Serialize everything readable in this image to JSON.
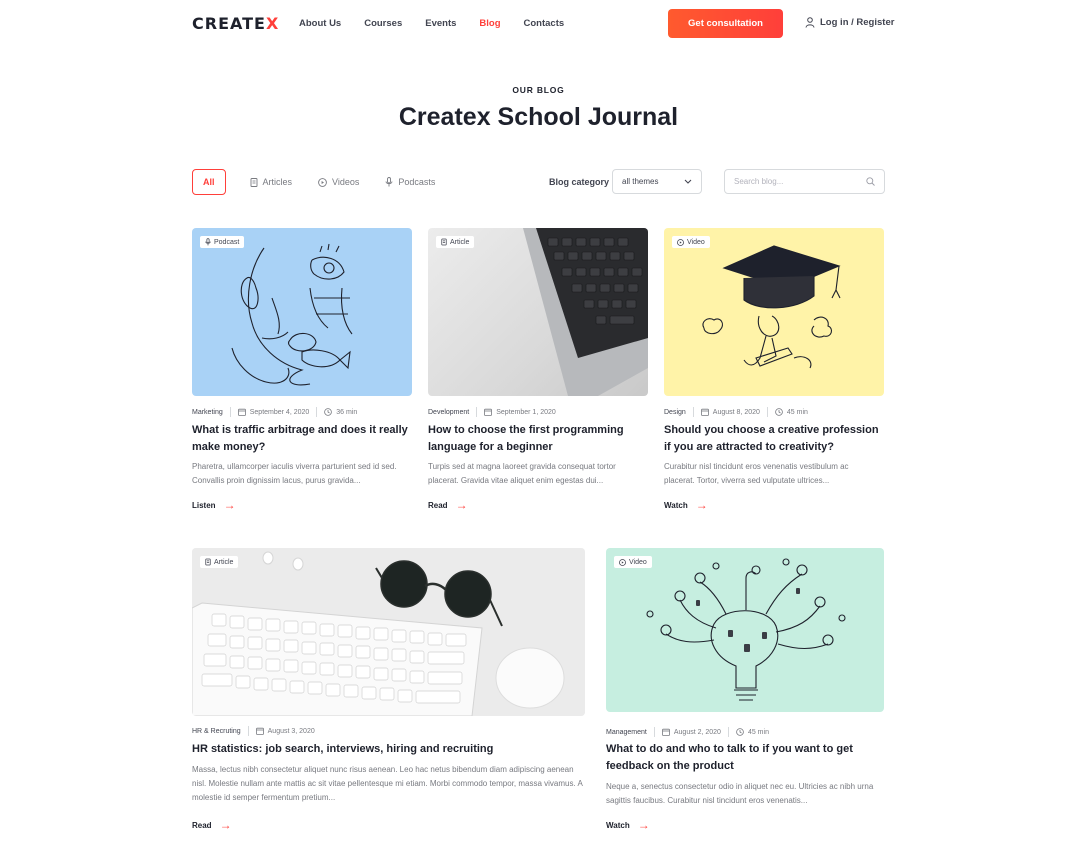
{
  "header": {
    "logo_main": "CREATE",
    "logo_x": "X",
    "nav": [
      "About Us",
      "Courses",
      "Events",
      "Blog",
      "Contacts"
    ],
    "active_nav": "Blog",
    "cta_label": "Get consultation",
    "login_label": "Log in / Register"
  },
  "hero": {
    "eyebrow": "OUR BLOG",
    "title": "Createx School Journal"
  },
  "filters": {
    "all": "All",
    "articles": "Articles",
    "videos": "Videos",
    "podcasts": "Podcasts",
    "category_label": "Blog category",
    "category_value": "all themes",
    "search_placeholder": "Search blog..."
  },
  "colors": {
    "accent": "#ff3f3a",
    "text_dark": "#1e212c",
    "text_muted": "#787a80",
    "podcast_bg": "#a9d2f6",
    "video_bg": "#fff3a8",
    "video2_bg": "#c6eee0"
  },
  "cards": [
    {
      "type": "Podcast",
      "type_icon": "microphone-icon",
      "category": "Marketing",
      "date": "September 4, 2020",
      "duration": "36 min",
      "title": "What is traffic arbitrage and does it really make money?",
      "excerpt": "Pharetra, ullamcorper iaculis viverra parturient sed id sed. Convallis proin dignissim lacus, purus gravida...",
      "action": "Listen"
    },
    {
      "type": "Article",
      "type_icon": "file-icon",
      "category": "Development",
      "date": "September 1, 2020",
      "duration": "",
      "title": "How to choose the first programming language for a beginner",
      "excerpt": "Turpis sed at magna laoreet gravida consequat tortor placerat. Gravida vitae aliquet enim egestas dui...",
      "action": "Read"
    },
    {
      "type": "Video",
      "type_icon": "play-icon",
      "category": "Design",
      "date": "August 8, 2020",
      "duration": "45 min",
      "title": "Should you choose a creative profession if you are attracted to creativity?",
      "excerpt": "Curabitur nisl tincidunt eros venenatis vestibulum ac placerat. Tortor, viverra sed vulputate ultrices...",
      "action": "Watch"
    },
    {
      "type": "Article",
      "type_icon": "file-icon",
      "category": "HR & Recruting",
      "date": "August 3, 2020",
      "duration": "",
      "title": "HR statistics: job search,  interviews, hiring and recruiting",
      "excerpt": "Massa, lectus nibh consectetur aliquet nunc risus aenean. Leo hac netus bibendum diam adipiscing aenean nisl. Molestie nullam ante mattis ac sit vitae pellentesque mi etiam. Morbi commodo tempor, massa vivamus. A molestie id semper fermentum pretium...",
      "action": "Read"
    },
    {
      "type": "Video",
      "type_icon": "play-icon",
      "category": "Management",
      "date": "August 2, 2020",
      "duration": "45 min",
      "title": "What to do and who to talk to if you want to get feedback on the product",
      "excerpt": "Neque a, senectus consectetur odio in aliquet nec eu. Ultricies ac nibh urna sagittis faucibus. Curabitur nisl tincidunt eros venenatis...",
      "action": "Watch"
    }
  ]
}
